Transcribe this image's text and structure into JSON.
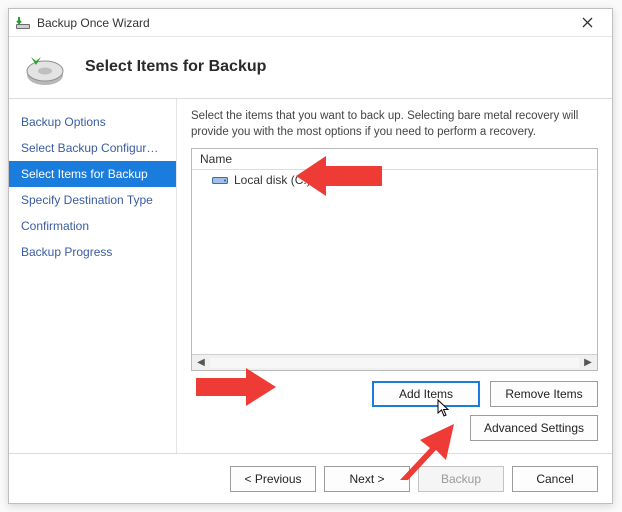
{
  "window": {
    "title": "Backup Once Wizard"
  },
  "header": {
    "title": "Select Items for Backup"
  },
  "nav": {
    "items": [
      {
        "label": "Backup Options",
        "selected": false
      },
      {
        "label": "Select Backup Configurat...",
        "selected": false
      },
      {
        "label": "Select Items for Backup",
        "selected": true
      },
      {
        "label": "Specify Destination Type",
        "selected": false
      },
      {
        "label": "Confirmation",
        "selected": false
      },
      {
        "label": "Backup Progress",
        "selected": false
      }
    ]
  },
  "content": {
    "instructions": "Select the items that you want to back up. Selecting bare metal recovery will provide you with the most options if you need to perform a recovery.",
    "list": {
      "header": "Name",
      "rows": [
        {
          "icon": "disk-icon",
          "label": "Local disk (C:)"
        }
      ]
    },
    "buttons": {
      "add": "Add Items",
      "remove": "Remove Items",
      "advanced": "Advanced Settings"
    }
  },
  "footer": {
    "previous": "< Previous",
    "next": "Next >",
    "backup": "Backup",
    "cancel": "Cancel"
  }
}
